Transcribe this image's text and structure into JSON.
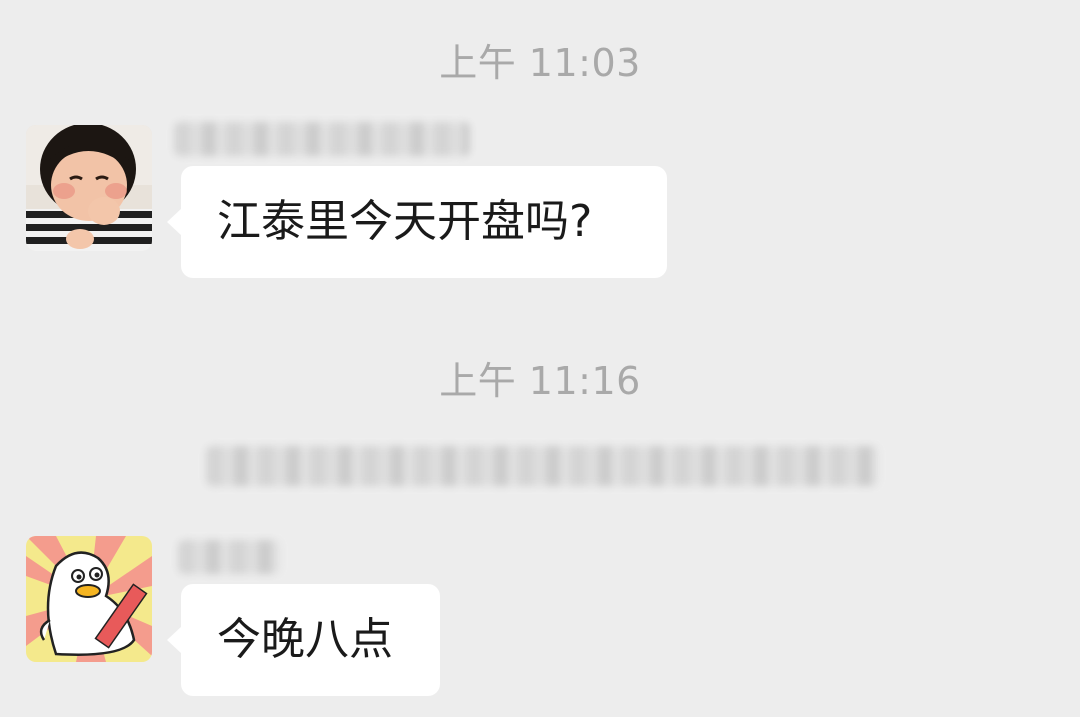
{
  "chat": {
    "messages": [
      {
        "timestamp": "上午 11:03",
        "sender_name_blurred": true,
        "text": "江泰里今天开盘吗?"
      },
      {
        "timestamp": "上午 11:16",
        "system_notice_blurred": true,
        "sender_name_blurred": true,
        "text": "今晚八点"
      }
    ]
  },
  "colors": {
    "background": "#ededed",
    "bubble": "#ffffff",
    "timestamp": "#a9a9a9",
    "text": "#1a1a1a"
  },
  "icons": {
    "avatar1": "child-photo-avatar",
    "avatar2": "cartoon-duck-avatar"
  }
}
